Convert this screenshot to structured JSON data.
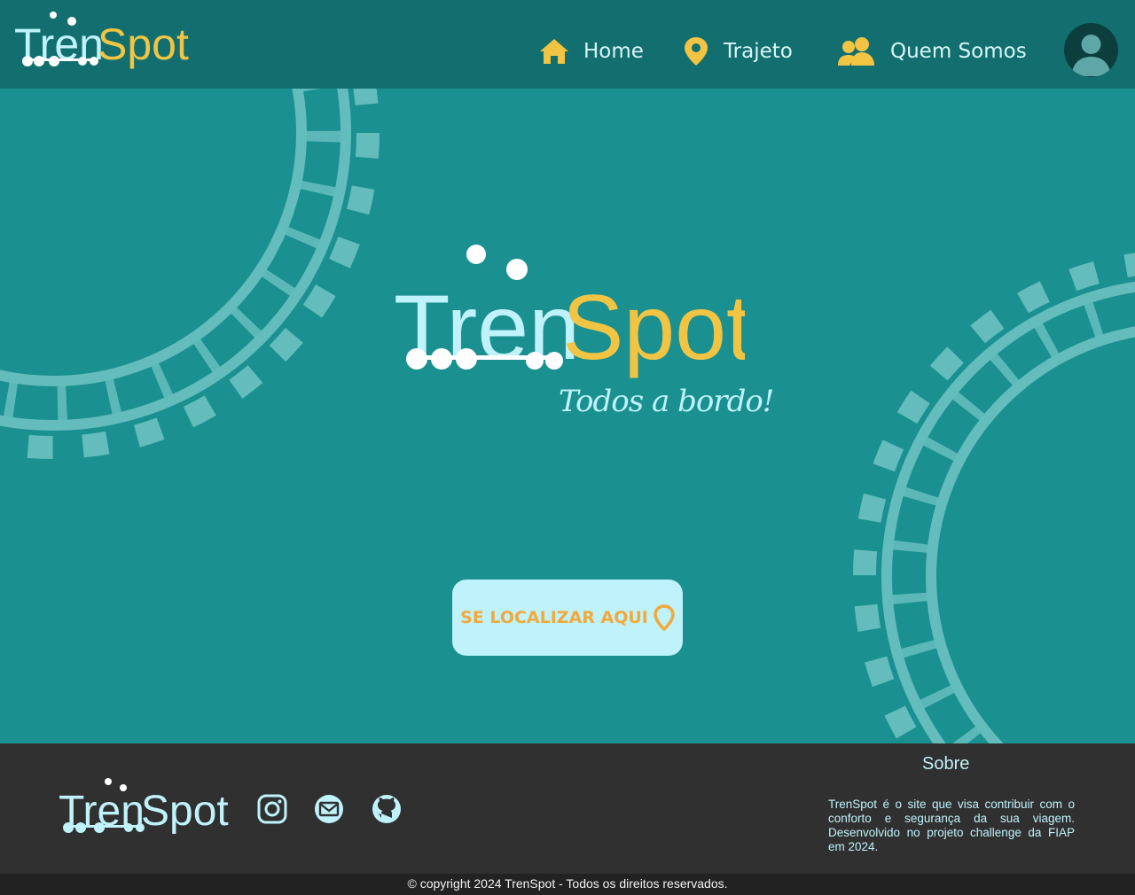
{
  "brand": {
    "name_part1": "Tren",
    "name_part2": "Spot",
    "tagline": "Todos a bordo!",
    "colors": {
      "primary": "#bff2fb",
      "accent": "#f2c443",
      "header_bg": "#136f6f",
      "main_bg": "#1b9090",
      "footer_bg": "#303030"
    }
  },
  "nav": {
    "items": [
      {
        "label": "Home",
        "icon": "home-icon"
      },
      {
        "label": "Trajeto",
        "icon": "map-pin-icon"
      },
      {
        "label": "Quem Somos",
        "icon": "users-icon"
      }
    ],
    "avatar_icon": "user-avatar-icon"
  },
  "hero": {
    "button_label": "SE LOCALIZAR AQUI",
    "button_icon": "map-pin-icon"
  },
  "footer": {
    "social": [
      "instagram-icon",
      "mail-icon",
      "github-icon"
    ],
    "about_title": "Sobre",
    "about_text": "TrenSpot é o site que visa contribuir com o conforto e segurança da sua viagem. Desenvolvido no projeto challenge da FIAP em 2024.",
    "copyright": "© copyright 2024 TrenSpot - Todos os direitos reservados."
  }
}
